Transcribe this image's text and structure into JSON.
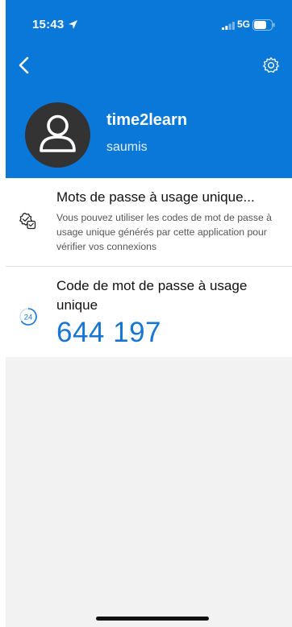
{
  "status_bar": {
    "time": "15:43",
    "network": "5G",
    "icons": [
      "location-arrow-icon",
      "signal-icon",
      "battery-icon"
    ]
  },
  "nav": {
    "back_icon": "chevron-left-icon",
    "settings_icon": "gear-icon"
  },
  "account": {
    "name": "time2learn",
    "username": "saumis",
    "avatar_icon": "person-icon"
  },
  "otp_info": {
    "title": "Mots de passe à usage unique...",
    "description": "Vous pouvez utiliser les codes de mot de passe à usage unique générés par cette application pour vérifier vos connexions",
    "icon": "verified-badge-icon"
  },
  "otp_code": {
    "title": "Code de mot de passe à usage unique",
    "code": "644 197",
    "timer": "24",
    "timer_icon": "countdown-timer-icon"
  },
  "colors": {
    "header_bg": "#0a78d8",
    "accent": "#1776d3",
    "background": "#f2f2f2"
  }
}
